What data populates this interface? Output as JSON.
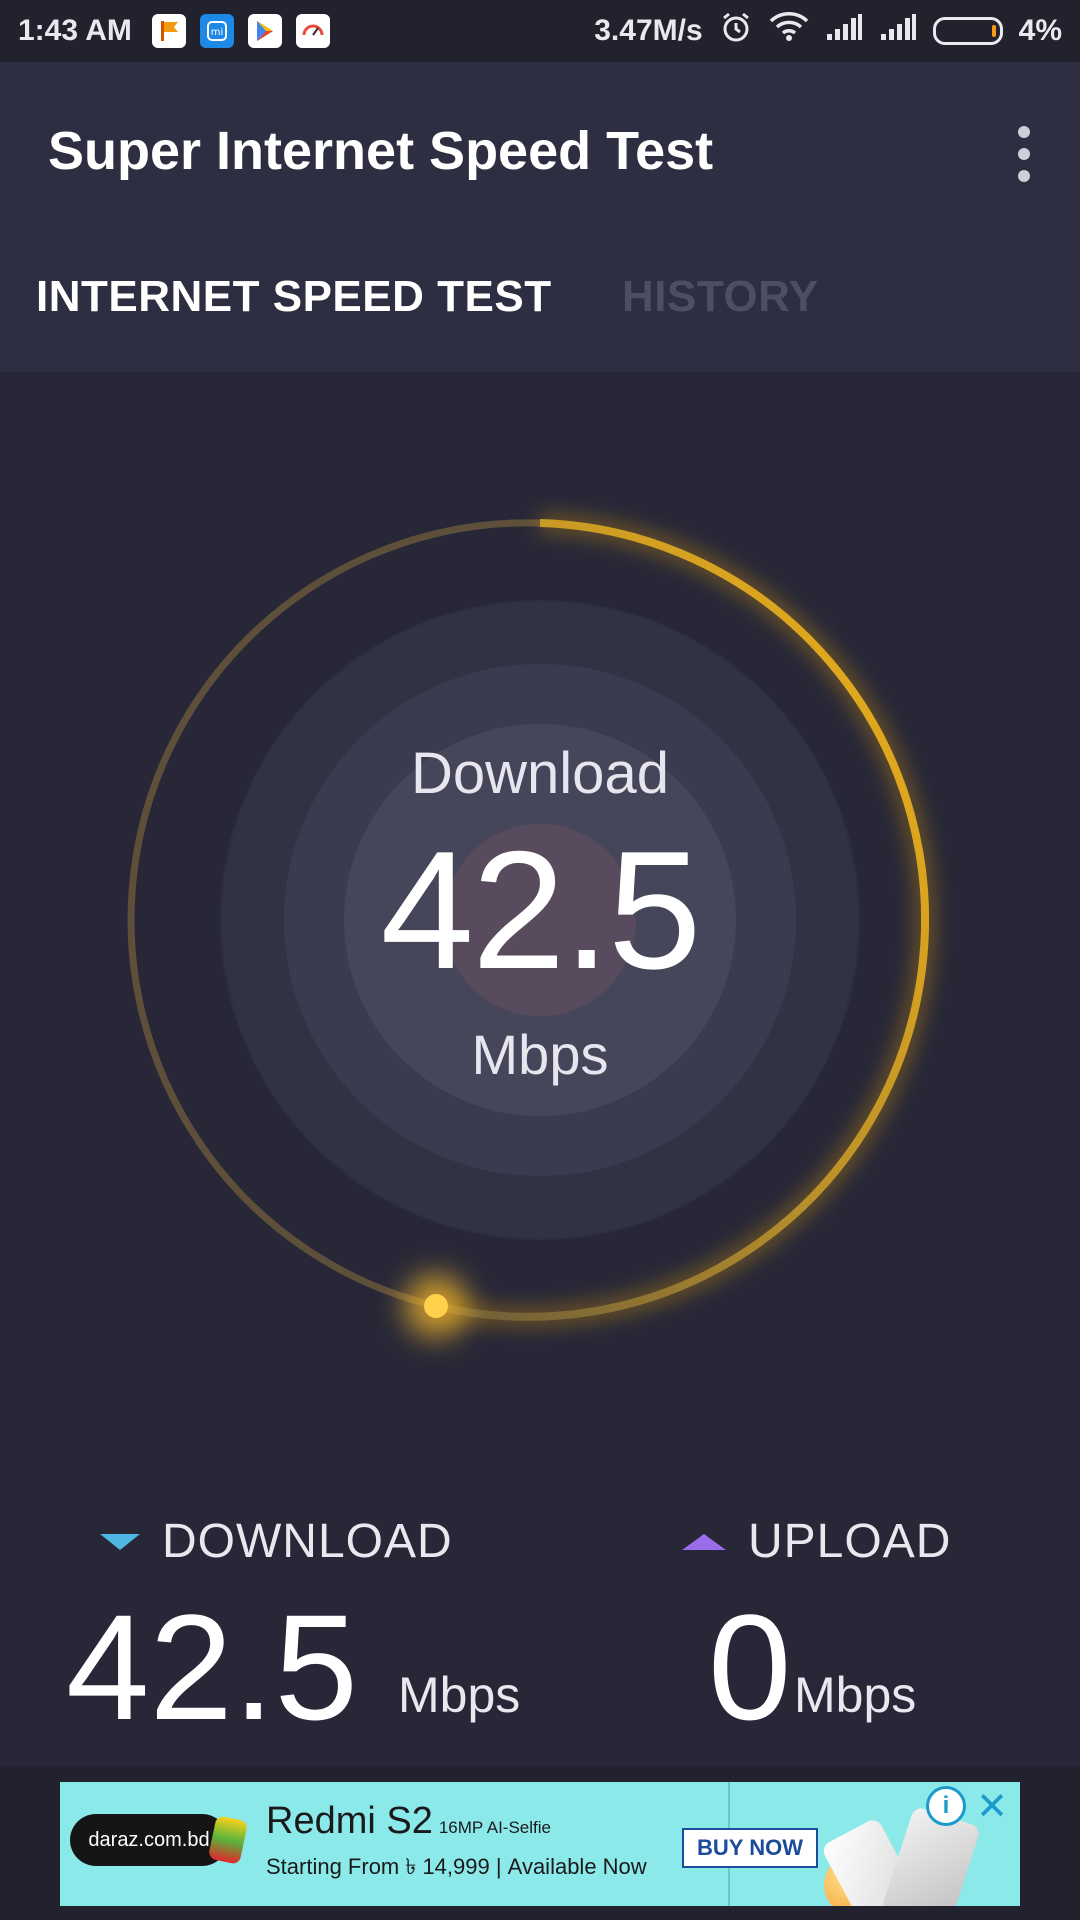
{
  "status_bar": {
    "time": "1:43 AM",
    "net_speed": "3.47M/s",
    "battery": "4%"
  },
  "app_bar": {
    "title": "Super Internet Speed Test",
    "tabs": [
      {
        "label": "INTERNET SPEED TEST",
        "active": true
      },
      {
        "label": "HISTORY",
        "active": false
      }
    ]
  },
  "gauge": {
    "title": "Download",
    "value": "42.5",
    "unit": "Mbps",
    "colors": {
      "arc": "#f2b318",
      "glow": "#ffd45c"
    }
  },
  "results": {
    "download": {
      "label": "DOWNLOAD",
      "value": "42.5",
      "unit": "Mbps",
      "icon": "triangle-down-icon"
    },
    "upload": {
      "label": "UPLOAD",
      "value": "0",
      "unit": "Mbps",
      "icon": "triangle-up-icon"
    }
  },
  "ad": {
    "brand": "daraz.com.bd",
    "title": "Redmi S2",
    "feature": "16MP AI-Selfie",
    "subtitle": "Starting From ৳ 14,999 | Available Now",
    "button": "BUY NOW"
  }
}
